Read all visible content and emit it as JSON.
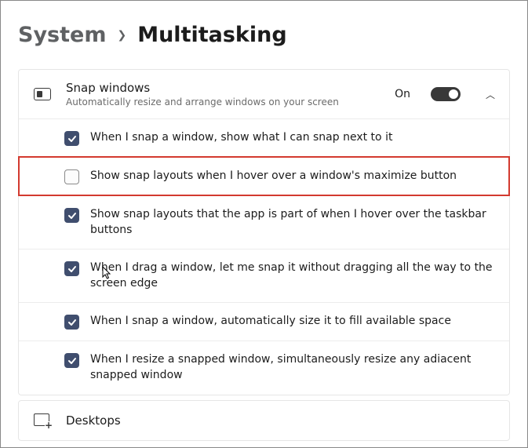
{
  "breadcrumb": {
    "parent": "System",
    "current": "Multitasking"
  },
  "snap": {
    "title": "Snap windows",
    "subtitle": "Automatically resize and arrange windows on your screen",
    "toggle_label": "On",
    "toggle_on": true,
    "expanded": true,
    "options": [
      {
        "checked": true,
        "label": "When I snap a window, show what I can snap next to it",
        "highlight": false
      },
      {
        "checked": false,
        "label": "Show snap layouts when I hover over a window's maximize button",
        "highlight": true
      },
      {
        "checked": true,
        "label": "Show snap layouts that the app is part of when I hover over the taskbar buttons",
        "highlight": false
      },
      {
        "checked": true,
        "label": "When I drag a window, let me snap it without dragging all the way to the screen edge",
        "highlight": false
      },
      {
        "checked": true,
        "label": "When I snap a window, automatically size it to fill available space",
        "highlight": false
      },
      {
        "checked": true,
        "label": "When I resize a snapped window, simultaneously resize any adiacent snapped window",
        "highlight": false
      }
    ]
  },
  "desktops": {
    "title": "Desktops"
  }
}
